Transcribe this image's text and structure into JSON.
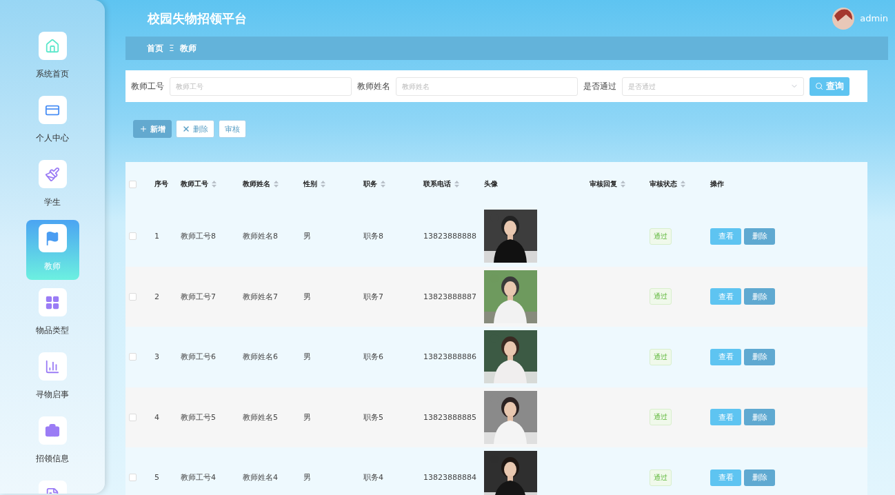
{
  "app_title": "校园失物招领平台",
  "user": {
    "name": "admin"
  },
  "breadcrumb": [
    {
      "label": "首页"
    },
    {
      "label": "Ξ",
      "kind": "separator"
    },
    {
      "label": "教师"
    }
  ],
  "sidebar": {
    "items": [
      {
        "label": "系统首页",
        "selected": false
      },
      {
        "label": "个人中心",
        "selected": false
      },
      {
        "label": "学生",
        "selected": false
      },
      {
        "label": "教师",
        "selected": true
      },
      {
        "label": "物品类型",
        "selected": false
      },
      {
        "label": "寻物启事",
        "selected": false
      },
      {
        "label": "招领信息",
        "selected": false
      },
      {
        "selected": false
      }
    ]
  },
  "search": {
    "fields": [
      {
        "label": "教师工号",
        "placeholder": "教师工号",
        "kind": "input"
      },
      {
        "label": "教师姓名",
        "placeholder": "教师姓名",
        "kind": "input"
      },
      {
        "label": "是否通过",
        "placeholder": "是否通过",
        "kind": "select"
      }
    ],
    "button": "查询"
  },
  "actions": [
    {
      "label": "新增",
      "kind": "add"
    },
    {
      "label": "删除",
      "kind": "delete"
    },
    {
      "label": "审核",
      "kind": "plain"
    }
  ],
  "table": {
    "all_checked": false,
    "columns": [
      {
        "label": "序号",
        "sortable": false
      },
      {
        "label": "教师工号",
        "sortable": true
      },
      {
        "label": "教师姓名",
        "sortable": true
      },
      {
        "label": "性别",
        "sortable": true
      },
      {
        "label": "职务",
        "sortable": true
      },
      {
        "label": "联系电话",
        "sortable": true
      },
      {
        "label": "头像",
        "sortable": false
      },
      {
        "label": "审核回复",
        "sortable": true
      },
      {
        "label": "审核状态",
        "sortable": true
      },
      {
        "label": "操作",
        "sortable": false
      }
    ],
    "rows": [
      {
        "checked": false,
        "no": "1",
        "id": "教师工号8",
        "name": "教师姓名8",
        "gender": "男",
        "title": "职务8",
        "phone": "13823888888",
        "photo": {
          "kind": "picture"
        },
        "status": "通过",
        "buttons": [
          "查看",
          "删除"
        ]
      },
      {
        "checked": false,
        "no": "2",
        "id": "教师工号7",
        "name": "教师姓名7",
        "gender": "男",
        "title": "职务7",
        "phone": "13823888887",
        "photo": {
          "kind": "picture"
        },
        "status": "通过",
        "buttons": [
          "查看",
          "删除"
        ]
      },
      {
        "checked": false,
        "no": "3",
        "id": "教师工号6",
        "name": "教师姓名6",
        "gender": "男",
        "title": "职务6",
        "phone": "13823888886",
        "photo": {
          "kind": "picture"
        },
        "status": "通过",
        "buttons": [
          "查看",
          "删除"
        ]
      },
      {
        "checked": false,
        "no": "4",
        "id": "教师工号5",
        "name": "教师姓名5",
        "gender": "男",
        "title": "职务5",
        "phone": "13823888885",
        "photo": {
          "kind": "picture"
        },
        "status": "通过",
        "buttons": [
          "查看",
          "删除"
        ]
      },
      {
        "checked": false,
        "no": "5",
        "id": "教师工号4",
        "name": "教师姓名4",
        "gender": "男",
        "title": "职务4",
        "phone": "13823888884",
        "photo": {
          "kind": "picture"
        },
        "status": "通过",
        "buttons": [
          "查看",
          "删除"
        ]
      }
    ]
  }
}
